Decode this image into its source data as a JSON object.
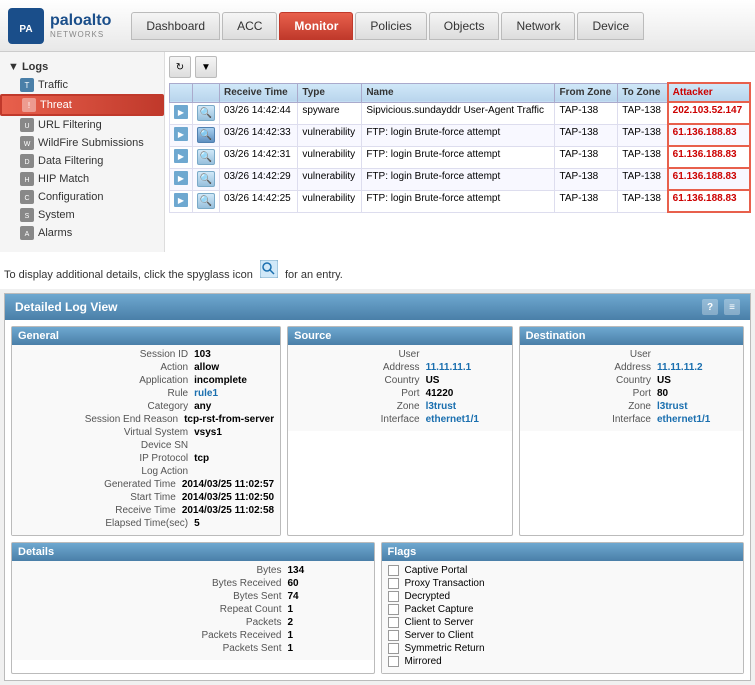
{
  "nav": {
    "logo": "paloalto",
    "logo_sub": "NETWORKS",
    "tabs": [
      {
        "label": "Dashboard",
        "active": false
      },
      {
        "label": "ACC",
        "active": false
      },
      {
        "label": "Monitor",
        "active": true
      },
      {
        "label": "Policies",
        "active": false
      },
      {
        "label": "Objects",
        "active": false
      },
      {
        "label": "Network",
        "active": false
      },
      {
        "label": "Device",
        "active": false
      }
    ]
  },
  "sidebar": {
    "section_label": "▼ Logs",
    "items": [
      {
        "label": "Traffic",
        "icon": "traffic",
        "active": false
      },
      {
        "label": "Threat",
        "icon": "threat",
        "active": true
      },
      {
        "label": "URL Filtering",
        "icon": "url",
        "active": false
      },
      {
        "label": "WildFire Submissions",
        "icon": "wildfire",
        "active": false
      },
      {
        "label": "Data Filtering",
        "icon": "data",
        "active": false
      },
      {
        "label": "HIP Match",
        "icon": "hip",
        "active": false
      },
      {
        "label": "Configuration",
        "icon": "config",
        "active": false
      },
      {
        "label": "System",
        "icon": "system",
        "active": false
      },
      {
        "label": "Alarms",
        "icon": "alarms",
        "active": false
      }
    ]
  },
  "log_table": {
    "columns": [
      "",
      "",
      "Receive Time",
      "Type",
      "Name",
      "From Zone",
      "To Zone",
      "Attacker"
    ],
    "rows": [
      {
        "receive_time": "03/26 14:42:44",
        "type": "spyware",
        "name": "Sipvicious.sundayddr User-Agent Traffic",
        "from_zone": "TAP-138",
        "to_zone": "TAP-138",
        "attacker": "202.103.52.147"
      },
      {
        "receive_time": "03/26 14:42:33",
        "type": "vulnerability",
        "name": "FTP: login Brute-force attempt",
        "from_zone": "TAP-138",
        "to_zone": "TAP-138",
        "attacker": "61.136.188.83"
      },
      {
        "receive_time": "03/26 14:42:31",
        "type": "vulnerability",
        "name": "FTP: login Brute-force attempt",
        "from_zone": "TAP-138",
        "to_zone": "TAP-138",
        "attacker": "61.136.188.83"
      },
      {
        "receive_time": "03/26 14:42:29",
        "type": "vulnerability",
        "name": "FTP: login Brute-force attempt",
        "from_zone": "TAP-138",
        "to_zone": "TAP-138",
        "attacker": "61.136.188.83"
      },
      {
        "receive_time": "03/26 14:42:25",
        "type": "vulnerability",
        "name": "FTP: login Brute-force attempt",
        "from_zone": "TAP-138",
        "to_zone": "TAP-138",
        "attacker": "61.136.188.83"
      }
    ]
  },
  "info_text": "To display additional details, click the spyglass icon",
  "info_text2": "for an entry.",
  "detail_view": {
    "title": "Detailed Log View",
    "general": {
      "header": "General",
      "fields": [
        {
          "label": "Session ID",
          "value": "103"
        },
        {
          "label": "Action",
          "value": "allow"
        },
        {
          "label": "Application",
          "value": "incomplete"
        },
        {
          "label": "Rule",
          "value": "rule1"
        },
        {
          "label": "Category",
          "value": "any"
        },
        {
          "label": "Session End Reason",
          "value": "tcp-rst-from-server"
        },
        {
          "label": "Virtual System",
          "value": "vsys1"
        },
        {
          "label": "Device SN",
          "value": ""
        },
        {
          "label": "IP Protocol",
          "value": "tcp"
        },
        {
          "label": "Log Action",
          "value": ""
        },
        {
          "label": "Generated Time",
          "value": "2014/03/25 11:02:57"
        },
        {
          "label": "Start Time",
          "value": "2014/03/25 11:02:50"
        },
        {
          "label": "Receive Time",
          "value": "2014/03/25 11:02:58"
        },
        {
          "label": "Elapsed Time(sec)",
          "value": "5"
        }
      ]
    },
    "source": {
      "header": "Source",
      "fields": [
        {
          "label": "User",
          "value": ""
        },
        {
          "label": "Address",
          "value": "11.11.11.1"
        },
        {
          "label": "Country",
          "value": "US"
        },
        {
          "label": "Port",
          "value": "41220"
        },
        {
          "label": "Zone",
          "value": "l3trust"
        },
        {
          "label": "Interface",
          "value": "ethernet1/1"
        }
      ]
    },
    "destination": {
      "header": "Destination",
      "fields": [
        {
          "label": "User",
          "value": ""
        },
        {
          "label": "Address",
          "value": "11.11.11.2"
        },
        {
          "label": "Country",
          "value": "US"
        },
        {
          "label": "Port",
          "value": "80"
        },
        {
          "label": "Zone",
          "value": "l3trust"
        },
        {
          "label": "Interface",
          "value": "ethernet1/1"
        }
      ]
    },
    "details": {
      "header": "Details",
      "fields": [
        {
          "label": "Bytes",
          "value": "134"
        },
        {
          "label": "Bytes Received",
          "value": "60"
        },
        {
          "label": "Bytes Sent",
          "value": "74"
        },
        {
          "label": "Repeat Count",
          "value": "1"
        },
        {
          "label": "Packets",
          "value": "2"
        },
        {
          "label": "Packets Received",
          "value": "1"
        },
        {
          "label": "Packets Sent",
          "value": "1"
        }
      ]
    },
    "flags": {
      "header": "Flags",
      "fields": [
        {
          "label": "Captive Portal",
          "checked": false
        },
        {
          "label": "Proxy Transaction",
          "checked": false
        },
        {
          "label": "Decrypted",
          "checked": false
        },
        {
          "label": "Packet Capture",
          "checked": false
        },
        {
          "label": "Client to Server",
          "checked": false
        },
        {
          "label": "Server to Client",
          "checked": false
        },
        {
          "label": "Symmetric Return",
          "checked": false
        },
        {
          "label": "Mirrored",
          "checked": false
        }
      ]
    }
  }
}
